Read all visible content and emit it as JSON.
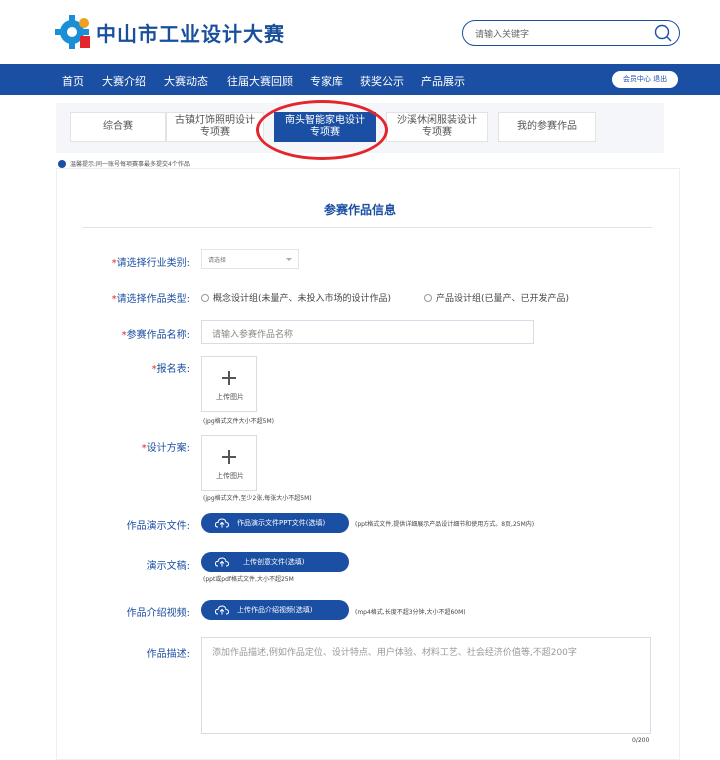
{
  "header": {
    "site_title": "中山市工业设计大赛",
    "search_placeholder": "请输入关键字"
  },
  "nav": {
    "items": [
      "首页",
      "大赛介绍",
      "大赛动态",
      "往届大赛回顾",
      "专家库",
      "获奖公示",
      "产品展示"
    ],
    "member_button": "会员中心 退出"
  },
  "tabs": [
    {
      "label": "综合赛",
      "active": false
    },
    {
      "label_line1": "古镇灯饰照明设计",
      "label_line2": "专项赛",
      "active": false
    },
    {
      "label_line1": "南头智能家电设计",
      "label_line2": "专项赛",
      "active": true
    },
    {
      "label_line1": "沙溪休闲服装设计",
      "label_line2": "专项赛",
      "active": false
    },
    {
      "label": "我的参赛作品",
      "active": false
    }
  ],
  "tip": "温馨提示:同一账号每项赛事最多提交4个作品",
  "form": {
    "title": "参赛作品信息",
    "industry": {
      "required": "*",
      "label": "请选择行业类别:",
      "value": "请选择"
    },
    "type": {
      "required": "*",
      "label": "请选择作品类型:",
      "options": [
        "概念设计组(未量产、未投入市场的设计作品)",
        "产品设计组(已量产、已开发产品)"
      ]
    },
    "name": {
      "required": "*",
      "label": "参赛作品名称:",
      "placeholder": "请输入参赛作品名称"
    },
    "registration": {
      "required": "*",
      "label": "报名表:",
      "upload": "上传图片",
      "hint": "(jpg格式文件大小不超5M)"
    },
    "design": {
      "required": "*",
      "label": "设计方案:",
      "upload": "上传图片",
      "hint": "(jpg格式文件,至少2张,每张大小不超5M)"
    },
    "ppt": {
      "label": "作品演示文件:",
      "button": "作品演示文件PPT文件(选填)",
      "hint": "(ppt格式文件,提供详细展示产品设计细节和使用方式。8页,25M内)"
    },
    "doc": {
      "label": "演示文稿:",
      "button": "上传创意文件(选填)",
      "hint": "(ppt或pdf格式文件,大小不超25M"
    },
    "video": {
      "label": "作品介绍视频:",
      "button": "上传作品介绍视频(选填)",
      "hint": "(mp4格式,长度不超3分钟,大小不超60M)"
    },
    "description": {
      "label": "作品描述:",
      "placeholder": "添加作品描述,例如作品定位、设计特点、用户体验、材料工艺、社会经济价值等,不超200字",
      "counter": "0/200"
    }
  },
  "colors": {
    "primary": "#1b4fa3",
    "required": "#e3262b",
    "annotation": "#e3262b"
  }
}
